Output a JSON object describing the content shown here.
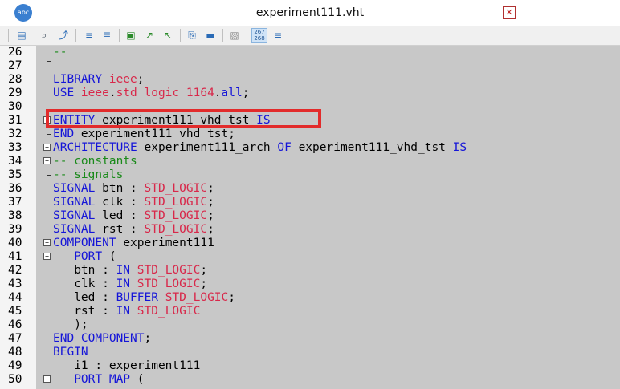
{
  "window": {
    "title": "experiment111.vht",
    "app_icon_label": "abc"
  },
  "toolbar": {
    "buttons": [
      {
        "name": "properties-icon",
        "glyph": "▤"
      },
      {
        "name": "find-icon",
        "glyph": "🔍"
      },
      {
        "name": "find-next-icon",
        "glyph": "⤴"
      },
      {
        "name": "indent-icon",
        "glyph": "≡"
      },
      {
        "name": "unindent-icon",
        "glyph": "≣"
      },
      {
        "name": "bookmark-toggle-icon",
        "glyph": "▣"
      },
      {
        "name": "bookmark-next-icon",
        "glyph": "↗"
      },
      {
        "name": "bookmark-prev-icon",
        "glyph": "↖"
      },
      {
        "name": "attach-icon",
        "glyph": "📎"
      },
      {
        "name": "insert-template-icon",
        "glyph": "▬"
      },
      {
        "name": "comment-icon",
        "glyph": "▧"
      },
      {
        "name": "line-numbers-icon",
        "glyph": "267\n268"
      },
      {
        "name": "align-icon",
        "glyph": "≡"
      }
    ]
  },
  "editor": {
    "lines": [
      {
        "n": "26",
        "tokens": [
          {
            "t": "--",
            "c": "cm"
          }
        ]
      },
      {
        "n": "27",
        "tokens": []
      },
      {
        "n": "28",
        "tokens": [
          {
            "t": "LIBRARY ",
            "c": "kw"
          },
          {
            "t": "ieee",
            "c": "ty"
          },
          {
            "t": ";",
            "c": ""
          }
        ]
      },
      {
        "n": "29",
        "tokens": [
          {
            "t": "USE ",
            "c": "kw"
          },
          {
            "t": "ieee",
            "c": "ty"
          },
          {
            "t": ".",
            "c": ""
          },
          {
            "t": "std_logic_1164",
            "c": "ty"
          },
          {
            "t": ".",
            "c": ""
          },
          {
            "t": "all",
            "c": "kw"
          },
          {
            "t": ";",
            "c": ""
          }
        ]
      },
      {
        "n": "30",
        "tokens": []
      },
      {
        "n": "31",
        "tokens": [
          {
            "t": "ENTITY ",
            "c": "kw"
          },
          {
            "t": "experiment111_vhd_tst ",
            "c": ""
          },
          {
            "t": "IS",
            "c": "kw"
          }
        ]
      },
      {
        "n": "32",
        "tokens": [
          {
            "t": "END ",
            "c": "kw"
          },
          {
            "t": "experiment111_vhd_tst;",
            "c": ""
          }
        ]
      },
      {
        "n": "33",
        "tokens": [
          {
            "t": "ARCHITECTURE ",
            "c": "kw"
          },
          {
            "t": "experiment111_arch ",
            "c": ""
          },
          {
            "t": "OF ",
            "c": "kw"
          },
          {
            "t": "experiment111_vhd_tst ",
            "c": ""
          },
          {
            "t": "IS",
            "c": "kw"
          }
        ]
      },
      {
        "n": "34",
        "tokens": [
          {
            "t": "-- constants",
            "c": "cm"
          }
        ]
      },
      {
        "n": "35",
        "tokens": [
          {
            "t": "-- signals",
            "c": "cm"
          }
        ]
      },
      {
        "n": "36",
        "tokens": [
          {
            "t": "SIGNAL ",
            "c": "kw"
          },
          {
            "t": "btn : ",
            "c": ""
          },
          {
            "t": "STD_LOGIC",
            "c": "ty"
          },
          {
            "t": ";",
            "c": ""
          }
        ]
      },
      {
        "n": "37",
        "tokens": [
          {
            "t": "SIGNAL ",
            "c": "kw"
          },
          {
            "t": "clk : ",
            "c": ""
          },
          {
            "t": "STD_LOGIC",
            "c": "ty"
          },
          {
            "t": ";",
            "c": ""
          }
        ]
      },
      {
        "n": "38",
        "tokens": [
          {
            "t": "SIGNAL ",
            "c": "kw"
          },
          {
            "t": "led : ",
            "c": ""
          },
          {
            "t": "STD_LOGIC",
            "c": "ty"
          },
          {
            "t": ";",
            "c": ""
          }
        ]
      },
      {
        "n": "39",
        "tokens": [
          {
            "t": "SIGNAL ",
            "c": "kw"
          },
          {
            "t": "rst : ",
            "c": ""
          },
          {
            "t": "STD_LOGIC",
            "c": "ty"
          },
          {
            "t": ";",
            "c": ""
          }
        ]
      },
      {
        "n": "40",
        "tokens": [
          {
            "t": "COMPONENT ",
            "c": "kw"
          },
          {
            "t": "experiment111",
            "c": ""
          }
        ]
      },
      {
        "n": "41",
        "tokens": [
          {
            "t": "   PORT ",
            "c": "kw"
          },
          {
            "t": "(",
            "c": ""
          }
        ]
      },
      {
        "n": "42",
        "tokens": [
          {
            "t": "   btn : ",
            "c": ""
          },
          {
            "t": "IN ",
            "c": "kw"
          },
          {
            "t": "STD_LOGIC",
            "c": "ty"
          },
          {
            "t": ";",
            "c": ""
          }
        ]
      },
      {
        "n": "43",
        "tokens": [
          {
            "t": "   clk : ",
            "c": ""
          },
          {
            "t": "IN ",
            "c": "kw"
          },
          {
            "t": "STD_LOGIC",
            "c": "ty"
          },
          {
            "t": ";",
            "c": ""
          }
        ]
      },
      {
        "n": "44",
        "tokens": [
          {
            "t": "   led : ",
            "c": ""
          },
          {
            "t": "BUFFER ",
            "c": "kw"
          },
          {
            "t": "STD_LOGIC",
            "c": "ty"
          },
          {
            "t": ";",
            "c": ""
          }
        ]
      },
      {
        "n": "45",
        "tokens": [
          {
            "t": "   rst : ",
            "c": ""
          },
          {
            "t": "IN ",
            "c": "kw"
          },
          {
            "t": "STD_LOGIC",
            "c": "ty"
          }
        ]
      },
      {
        "n": "46",
        "tokens": [
          {
            "t": "   );",
            "c": ""
          }
        ]
      },
      {
        "n": "47",
        "tokens": [
          {
            "t": "END COMPONENT",
            "c": "kw"
          },
          {
            "t": ";",
            "c": ""
          }
        ]
      },
      {
        "n": "48",
        "tokens": [
          {
            "t": "BEGIN",
            "c": "kw"
          }
        ]
      },
      {
        "n": "49",
        "tokens": [
          {
            "t": "   i1 : experiment111",
            "c": ""
          }
        ]
      },
      {
        "n": "50",
        "tokens": [
          {
            "t": "   PORT MAP ",
            "c": "kw"
          },
          {
            "t": "(",
            "c": ""
          }
        ]
      }
    ],
    "highlighted_line": "31"
  },
  "colors": {
    "keyword": "#1515d8",
    "type": "#d8284a",
    "comment": "#1a8a1a",
    "highlight_box": "#e22b2b",
    "editor_bg": "#c8c8c8"
  }
}
